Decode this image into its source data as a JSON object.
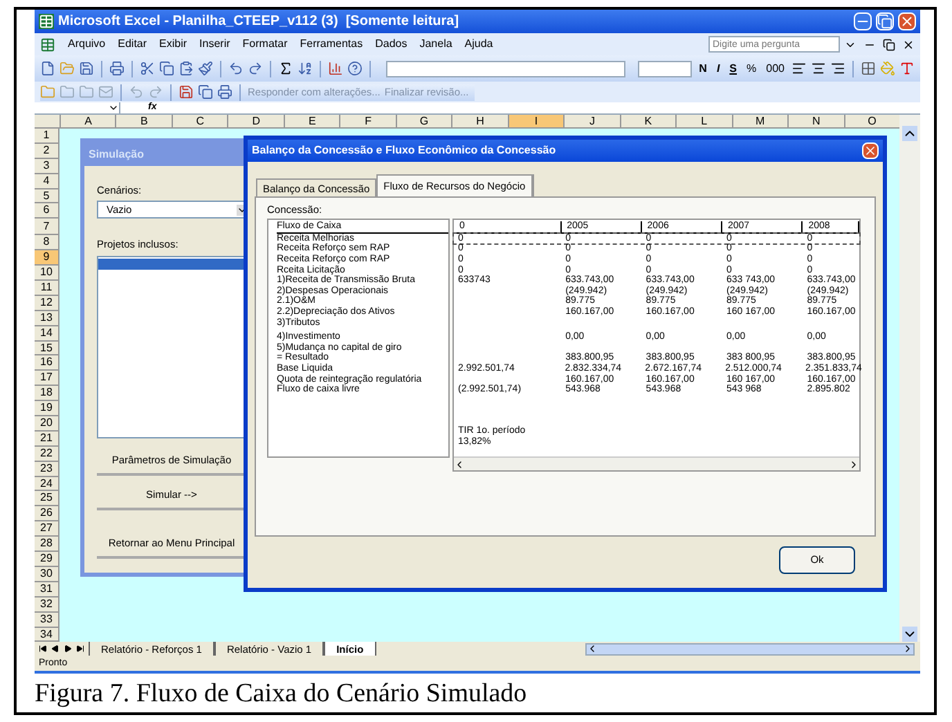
{
  "window": {
    "title": "Microsoft Excel - Planilha_CTEEP_v112 (3)  [Somente leitura]"
  },
  "menu": [
    "Arquivo",
    "Editar",
    "Exibir",
    "Inserir",
    "Formatar",
    "Ferramentas",
    "Dados",
    "Janela",
    "Ajuda"
  ],
  "help_search": {
    "placeholder": "Digite uma pergunta"
  },
  "format_toolbar": [
    {
      "kind": "bold",
      "label": "N"
    },
    {
      "kind": "italic",
      "label": "I"
    },
    {
      "kind": "underline",
      "label": "S"
    },
    {
      "kind": "plain",
      "label": "%"
    },
    {
      "kind": "plain",
      "label": "000"
    }
  ],
  "review_toolbar": [
    "Responder com alterações...",
    "Finalizar revisão..."
  ],
  "formula_bar": {
    "fx": "fx"
  },
  "columns": [
    {
      "label": "A",
      "selected": false
    },
    {
      "label": "B",
      "selected": false
    },
    {
      "label": "C",
      "selected": false
    },
    {
      "label": "D",
      "selected": false
    },
    {
      "label": "E",
      "selected": false
    },
    {
      "label": "F",
      "selected": false
    },
    {
      "label": "G",
      "selected": false
    },
    {
      "label": "H",
      "selected": false
    },
    {
      "label": "I",
      "selected": true
    },
    {
      "label": "J",
      "selected": false
    },
    {
      "label": "K",
      "selected": false
    },
    {
      "label": "L",
      "selected": false
    },
    {
      "label": "M",
      "selected": false
    },
    {
      "label": "N",
      "selected": false
    },
    {
      "label": "O",
      "selected": false
    }
  ],
  "rows": [
    {
      "label": "1",
      "selected": false
    },
    {
      "label": "2",
      "selected": false
    },
    {
      "label": "3",
      "selected": false
    },
    {
      "label": "4",
      "selected": false
    },
    {
      "label": "5",
      "selected": false
    },
    {
      "label": "6",
      "selected": false
    },
    {
      "label": "7",
      "selected": false
    },
    {
      "label": "8",
      "selected": false
    },
    {
      "label": "9",
      "selected": true
    },
    {
      "label": "10",
      "selected": false
    },
    {
      "label": "11",
      "selected": false
    },
    {
      "label": "12",
      "selected": false
    },
    {
      "label": "13",
      "selected": false
    },
    {
      "label": "14",
      "selected": false
    },
    {
      "label": "15",
      "selected": false
    },
    {
      "label": "16",
      "selected": false
    },
    {
      "label": "17",
      "selected": false
    },
    {
      "label": "18",
      "selected": false
    },
    {
      "label": "19",
      "selected": false
    },
    {
      "label": "20",
      "selected": false
    },
    {
      "label": "21",
      "selected": false
    },
    {
      "label": "22",
      "selected": false
    },
    {
      "label": "23",
      "selected": false
    },
    {
      "label": "24",
      "selected": false
    },
    {
      "label": "25",
      "selected": false
    },
    {
      "label": "26",
      "selected": false
    },
    {
      "label": "27",
      "selected": false
    },
    {
      "label": "28",
      "selected": false
    },
    {
      "label": "29",
      "selected": false
    },
    {
      "label": "30",
      "selected": false
    },
    {
      "label": "31",
      "selected": false
    },
    {
      "label": "32",
      "selected": false
    },
    {
      "label": "33",
      "selected": false
    },
    {
      "label": "34",
      "selected": false
    }
  ],
  "simulation_dialog": {
    "title": "Simulação",
    "active": false,
    "scenarios_label": "Cenários:",
    "scenario": {
      "value": "Vazio"
    },
    "projects_label": "Projetos inclusos:",
    "projects_list": {
      "first_row_selected": true
    },
    "buttons": [
      "Parâmetros de Simulação",
      "Simular -->",
      "Retornar ao Menu Principal"
    ]
  },
  "flow_dialog": {
    "title": "Balanço da Concessão e Fluxo Econômico da Concessão",
    "active": true,
    "tabs": [
      {
        "label": "Balanço da Concessão",
        "selected": false
      },
      {
        "label": "Fluxo de Recursos do Negócio",
        "selected": true
      }
    ],
    "group_label": "Concessão:",
    "header": {
      "label": "Fluxo de Caixa",
      "values": [
        "0",
        "2005",
        "2006",
        "2007",
        "2008"
      ]
    },
    "lines": [
      {
        "label": "Receita Melhorias",
        "focused": true,
        "kind": "full",
        "values": [
          "0",
          "0",
          "0",
          "0",
          "0"
        ]
      },
      {
        "label": "Receita Reforço sem RAP",
        "focused": false,
        "kind": "full",
        "values": [
          "0",
          "0",
          "0",
          "0",
          "0"
        ]
      },
      {
        "label": "Receita Reforço com RAP",
        "focused": false,
        "kind": "full",
        "values": [
          "0",
          "0",
          "0",
          "0",
          "0"
        ]
      },
      {
        "label": "Rceita Licitação",
        "focused": false,
        "kind": "full",
        "values": [
          "0",
          "0",
          "0",
          "0",
          "0"
        ]
      },
      {
        "label": "1)Receita de Transmissão Bruta",
        "focused": false,
        "kind": "full",
        "values": [
          "633743",
          "633.743,00",
          "633.743,00",
          "633 743,00",
          "633.743,00"
        ]
      },
      {
        "label": "2)Despesas Operacionais",
        "focused": false,
        "kind": "years",
        "values": [
          "(249.942)",
          "(249.942)",
          "(249.942)",
          "(249.942)"
        ]
      },
      {
        "label": "2.1)O&M",
        "focused": false,
        "kind": "years",
        "values": [
          "89.775",
          "89.775",
          "89.775",
          "89.775"
        ]
      },
      {
        "label": "2.2)Depreciação dos Ativos",
        "focused": false,
        "kind": "years",
        "values": [
          "160.167,00",
          "160.167,00",
          "160 167,00",
          "160.167,00"
        ]
      },
      {
        "label": "3)Tributos",
        "focused": false,
        "kind": "label"
      },
      {
        "label": "4)Investimento",
        "focused": false,
        "kind": "years",
        "values": [
          "0,00",
          "0,00",
          "0,00",
          "0,00"
        ]
      },
      {
        "label": "5)Mudança no capital de giro",
        "focused": false,
        "kind": "label"
      },
      {
        "label": "= Resultado",
        "focused": false,
        "kind": "years",
        "values": [
          "383.800,95",
          "383.800,95",
          "383 800,95",
          "383.800,95"
        ]
      },
      {
        "label": "Base Liquida",
        "focused": false,
        "kind": "full",
        "values": [
          "2.992.501,74",
          "2.832.334,74",
          "2.672.167,74",
          "2.512.000,74",
          "2.351.833,74"
        ]
      },
      {
        "label": "Quota de reintegração regulatória",
        "focused": false,
        "kind": "years",
        "values": [
          "160.167,00",
          "160.167,00",
          "160 167,00",
          "160.167,00"
        ]
      },
      {
        "label": "Fluxo de caixa livre",
        "focused": false,
        "kind": "full",
        "values": [
          "(2.992.501,74)",
          "543.968",
          "543.968",
          "543 968",
          "2.895.802"
        ]
      }
    ],
    "summary": [
      "TIR 1o. período",
      "13,82%"
    ],
    "ok_button": "Ok"
  },
  "sheet_tabs": [
    {
      "label": "Relatório - Reforços 1",
      "selected": false
    },
    {
      "label": "Relatório - Vazio 1",
      "selected": false
    },
    {
      "label": "Início",
      "selected": true
    }
  ],
  "status_bar": "Pronto",
  "caption": "Figura 7. Fluxo de Caixa do Cenário Simulado"
}
